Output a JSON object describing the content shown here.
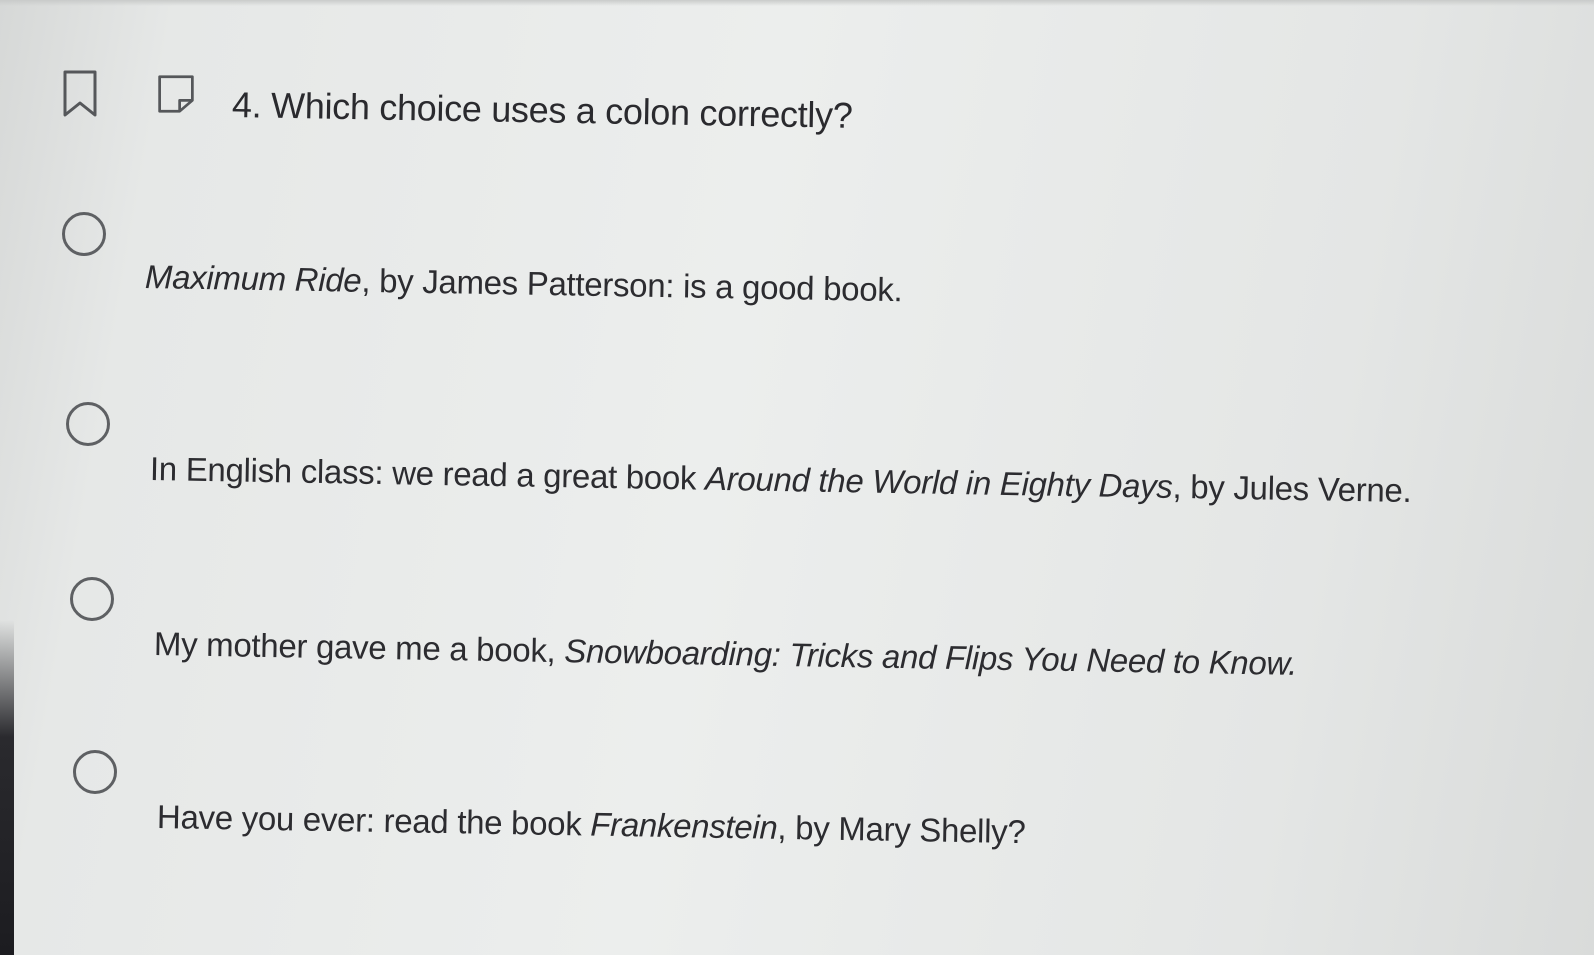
{
  "toolbar": {
    "bookmark_icon": "bookmark-icon",
    "note_icon": "note-icon"
  },
  "question": {
    "number": "4.",
    "text": "Which choice uses a colon correctly?"
  },
  "options": [
    {
      "segments": [
        {
          "text": "Maximum Ride",
          "italic": true
        },
        {
          "text": ", by James Patterson: is a good book.",
          "italic": false
        }
      ]
    },
    {
      "segments": [
        {
          "text": "In English class: we read a great book ",
          "italic": false
        },
        {
          "text": "Around the World in Eighty Days",
          "italic": true
        },
        {
          "text": ", by Jules Verne.",
          "italic": false
        }
      ]
    },
    {
      "segments": [
        {
          "text": "My mother gave me a book, ",
          "italic": false
        },
        {
          "text": "Snowboarding: Tricks and Flips You Need to Know.",
          "italic": true
        }
      ]
    },
    {
      "segments": [
        {
          "text": "Have you ever: read the book ",
          "italic": false
        },
        {
          "text": "Frankenstein",
          "italic": true
        },
        {
          "text": ", by Mary Shelly?",
          "italic": false
        }
      ]
    }
  ],
  "colors": {
    "text": "#2a2a2e",
    "radio_border": "#5e6063",
    "icon_stroke": "#55575a"
  }
}
